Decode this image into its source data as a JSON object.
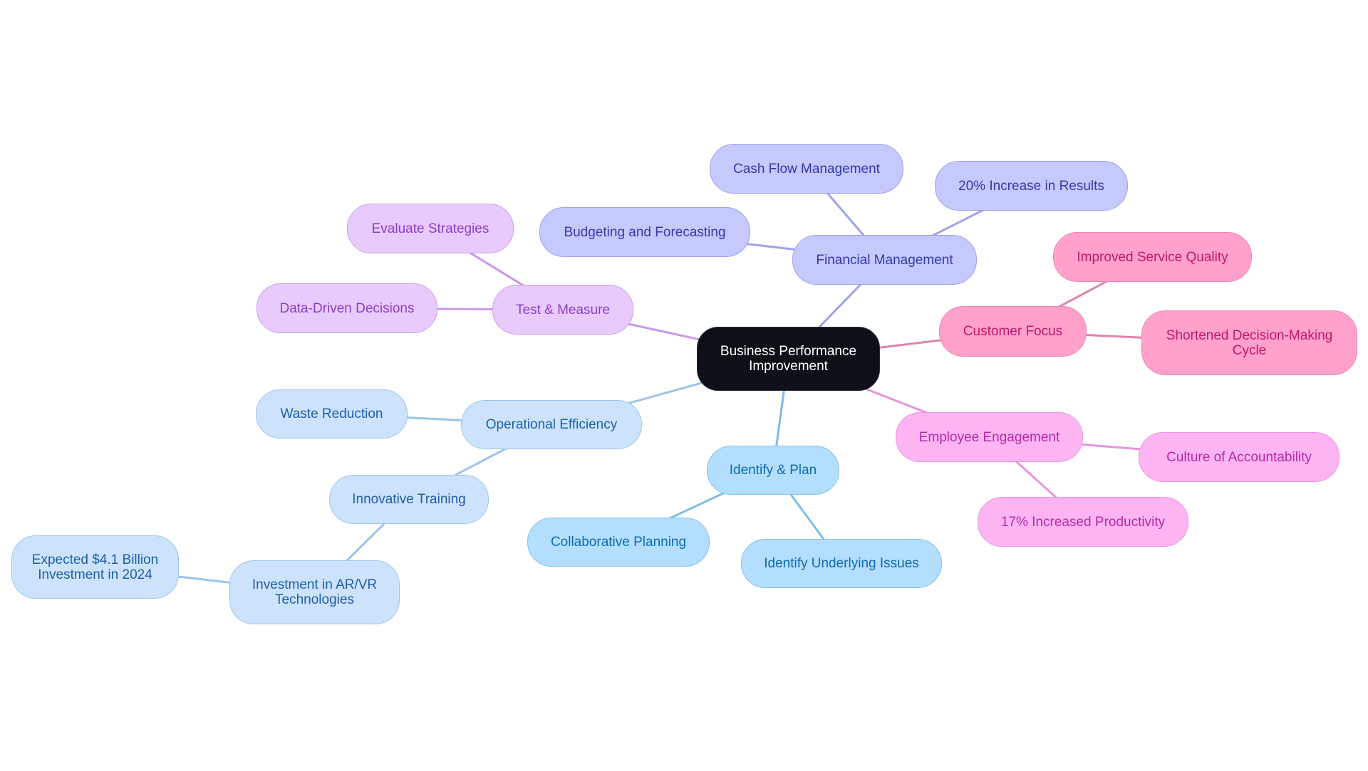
{
  "root": {
    "label": "Business Performance Improvement"
  },
  "branches": {
    "financial": {
      "label": "Financial Management",
      "color": "#9ea3ea",
      "children": [
        "Cash Flow Management",
        "20% Increase in Results",
        "Budgeting and Forecasting"
      ]
    },
    "customer": {
      "label": "Customer Focus",
      "color": "#e083b0",
      "children": [
        "Improved Service Quality",
        "Shortened Decision-Making Cycle"
      ]
    },
    "employee": {
      "label": "Employee Engagement",
      "color": "#e695dd",
      "children": [
        "Culture of Accountability",
        "17% Increased Productivity"
      ]
    },
    "identify": {
      "label": "Identify & Plan",
      "color": "#7dbde8",
      "children": [
        "Collaborative Planning",
        "Identify Underlying Issues"
      ]
    },
    "operational": {
      "label": "Operational Efficiency",
      "color": "#9ec4ea",
      "children": [
        "Waste Reduction",
        "Innovative Training"
      ],
      "grandchildren": {
        "innovative_training": [
          "Investment in AR/VR Technologies"
        ],
        "ar_vr": [
          "Expected $4.1 Billion Investment in 2024"
        ]
      }
    },
    "test": {
      "label": "Test & Measure",
      "color": "#c898ea",
      "children": [
        "Evaluate Strategies",
        "Data-Driven Decisions"
      ]
    }
  }
}
